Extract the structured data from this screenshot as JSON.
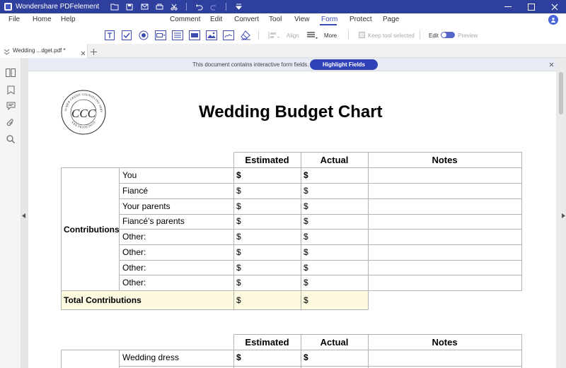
{
  "app": {
    "title": "Wondershare PDFelement"
  },
  "menu": {
    "left": [
      "File",
      "Home",
      "Help"
    ],
    "main": [
      "Comment",
      "Edit",
      "Convert",
      "Tool",
      "View",
      "Form",
      "Protect",
      "Page"
    ],
    "active": "Form"
  },
  "toolbar": {
    "tools": [
      "text-field-icon",
      "check-box-icon",
      "radio-button-icon",
      "combo-box-icon",
      "list-box-icon",
      "image-field-icon",
      "button-icon",
      "clear-form-icon"
    ],
    "align_label": "Align",
    "more_label": "More",
    "keep_tool_label": "Keep tool selected",
    "edit_label": "Edit",
    "preview_label": "Preview"
  },
  "tab": {
    "label": "Wedding ...dget.pdf *"
  },
  "notice": {
    "text": "This document contains interactive form fields.",
    "button": "Highlight Fields"
  },
  "document": {
    "title": "Wedding Budget Chart",
    "seal_text": {
      "top": "CONSUMER CREDIT COUNSELING SERVICE",
      "bottom": "SAN FRANCISCO",
      "monogram": "CCC"
    },
    "table1": {
      "headers": [
        "Estimated",
        "Actual",
        "Notes"
      ],
      "group_label": "Contributions",
      "rows": [
        {
          "label": "You",
          "estimated": "$",
          "actual": "$"
        },
        {
          "label": "Fiancé",
          "estimated": "$",
          "actual": "$"
        },
        {
          "label": "Your parents",
          "estimated": "$",
          "actual": "$"
        },
        {
          "label": "Fiancé’s parents",
          "estimated": "$",
          "actual": "$"
        },
        {
          "label": "Other:",
          "estimated": "$",
          "actual": "$"
        },
        {
          "label": "Other:",
          "estimated": "$",
          "actual": "$"
        },
        {
          "label": "Other:",
          "estimated": "$",
          "actual": "$"
        },
        {
          "label": "Other:",
          "estimated": "$",
          "actual": "$"
        }
      ],
      "total": {
        "label": "Total Contributions",
        "estimated": "$",
        "actual": "$"
      }
    },
    "table2": {
      "headers": [
        "Estimated",
        "Actual",
        "Notes"
      ],
      "rows": [
        {
          "label": "Wedding dress",
          "estimated": "$",
          "actual": "$"
        }
      ]
    }
  },
  "colors": {
    "titlebar": "#2f3f9e",
    "accent": "#3142b8",
    "total_row": "#fefadf"
  }
}
